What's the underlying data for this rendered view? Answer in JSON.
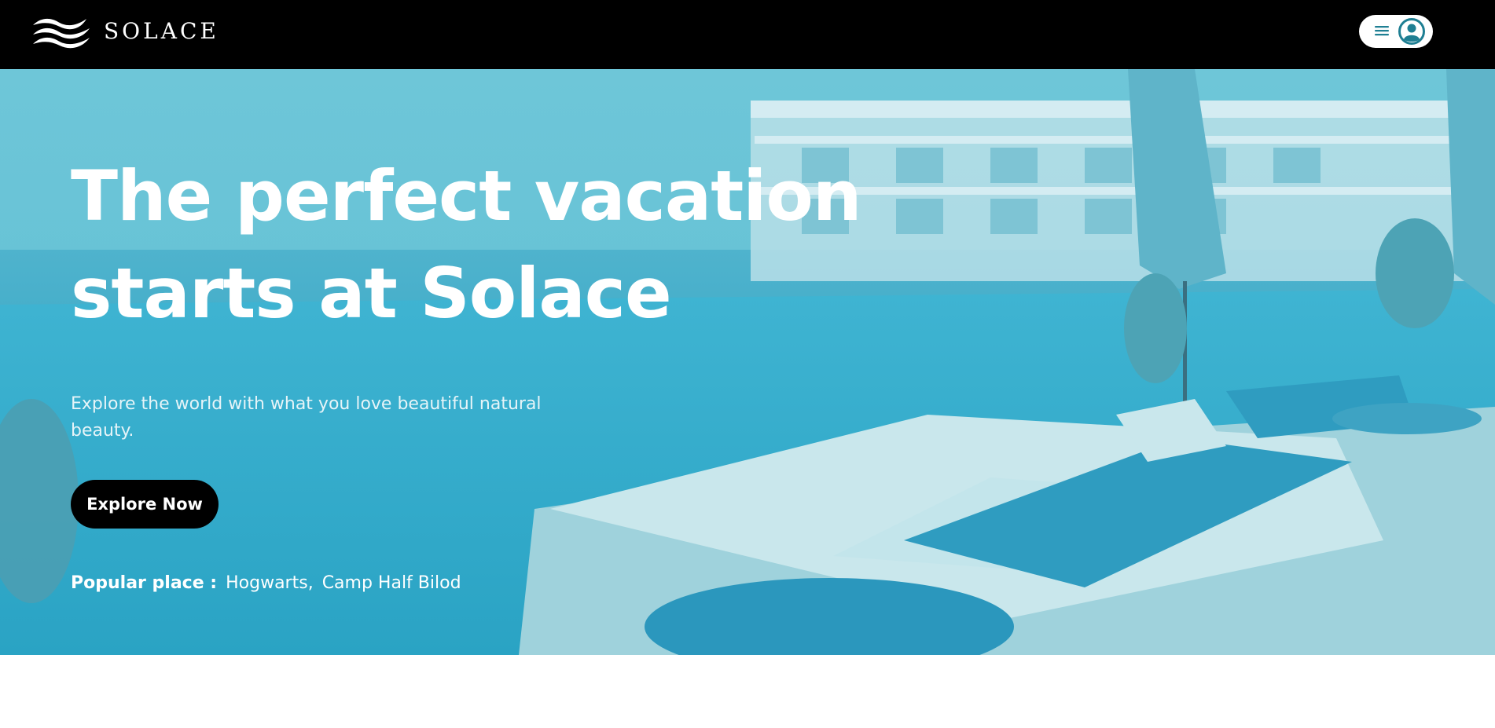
{
  "brand": {
    "name": "SOLACE",
    "logo_icon": "waves-logo-icon"
  },
  "header": {
    "menu_icon": "hamburger-menu-icon",
    "account_icon": "user-account-icon"
  },
  "hero": {
    "title_line1": "The perfect vacation",
    "title_line2": "starts at Solace",
    "subtitle": "Explore the world with what you love beautiful natural beauty.",
    "cta_label": "Explore Now",
    "popular_label": "Popular place :",
    "popular_places": [
      "Hogwarts",
      "Camp Half Bilod"
    ],
    "popular_separator": ","
  },
  "colors": {
    "navbar": "#000000",
    "hero_overlay": "#3fb2cc",
    "cta_background": "#000000",
    "text_light": "#ffffff"
  }
}
